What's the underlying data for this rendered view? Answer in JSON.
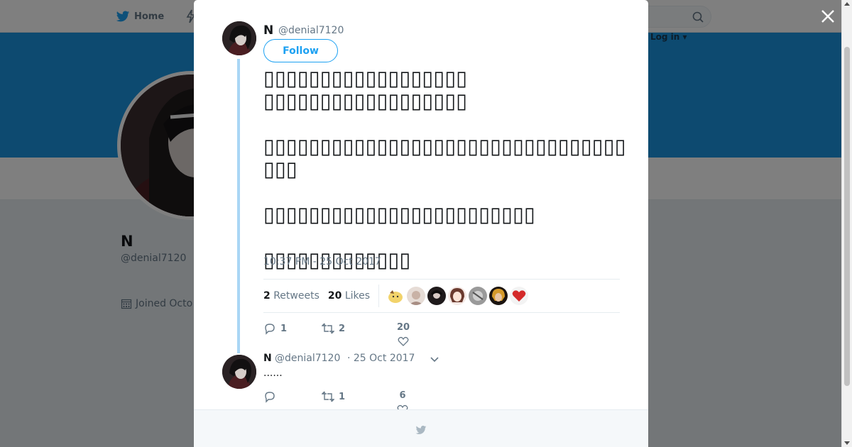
{
  "nav": {
    "home_label": "Home",
    "login_label": "Log in ▾"
  },
  "profile": {
    "name": "N",
    "handle": "@denial7120",
    "joined": "Joined Octo"
  },
  "tweet": {
    "author_name": "N",
    "author_handle": "@denial7120",
    "follow_label": "Follow",
    "text": "▯▯▯▯▯▯▯▯▯▯▯▯▯▯▯▯▯▯\n▯▯▯▯▯▯▯▯▯▯▯▯▯▯▯▯▯▯\n\n▯▯▯▯▯▯▯▯▯▯▯▯▯▯▯▯▯▯▯▯▯▯▯▯▯▯▯▯▯▯▯▯▯▯▯\n\n▯▯▯▯▯▯▯▯▯▯▯▯▯▯▯▯▯▯▯▯▯▯▯▯\n\n▯▯▯▯▯▯▯▯▯▯▯▯▯",
    "timestamp": "10:37 PM - 25 Oct 2017",
    "retweets_count": "2",
    "retweets_label": "Retweets",
    "likes_count": "20",
    "likes_label": "Likes",
    "reply_count": "1",
    "retweet_action_count": "2",
    "like_action_count": "20"
  },
  "reply": {
    "author_name": "N",
    "author_handle": "@denial7120",
    "date": "· 25 Oct 2017",
    "text": "......",
    "reply_count": "",
    "retweet_count": "1",
    "like_count": "6"
  },
  "colors": {
    "accent": "#1da1f2",
    "banner": "#1b95e0",
    "thread_line": "#a9d6f5"
  }
}
